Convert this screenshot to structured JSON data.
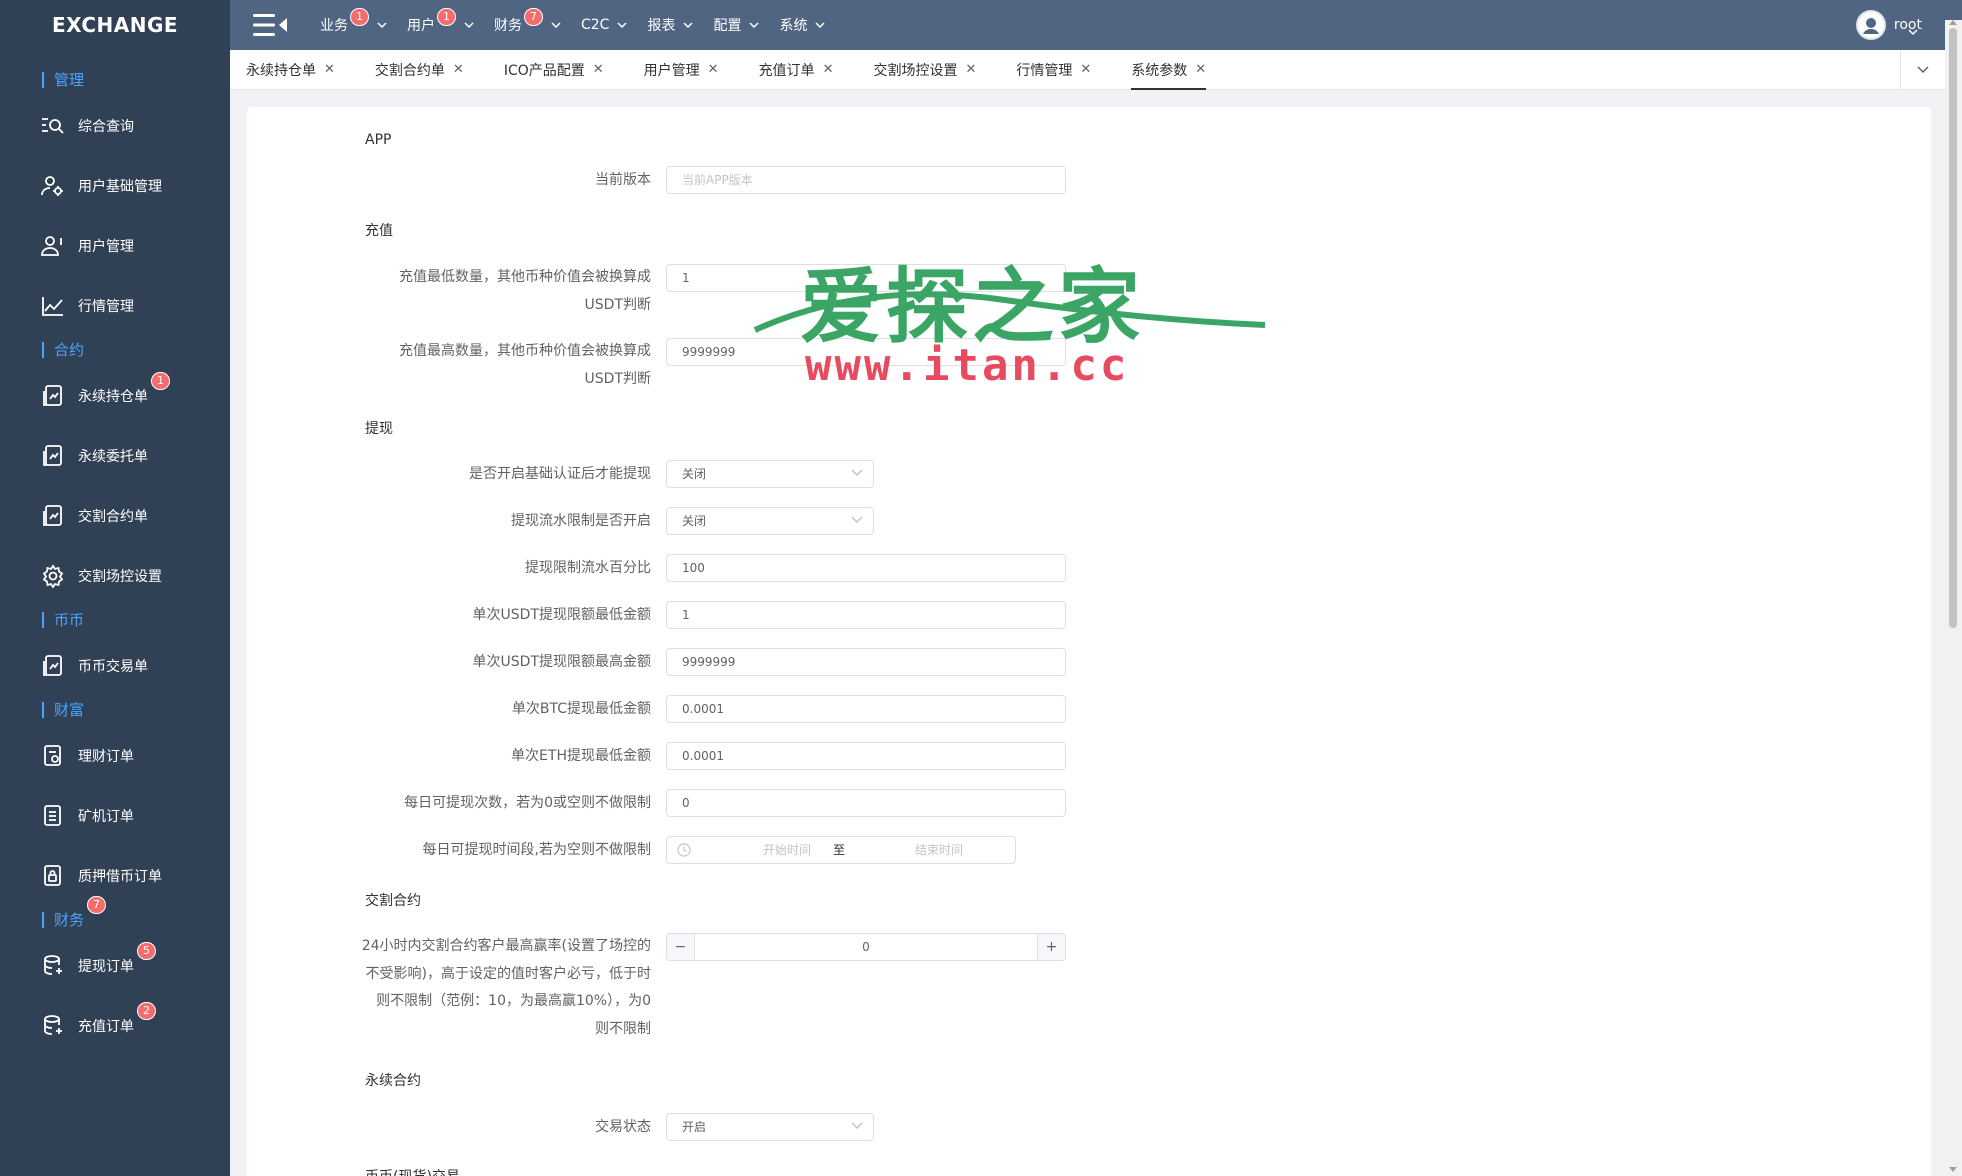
{
  "app": {
    "logo": "EXCHANGE"
  },
  "sidebar": {
    "groups": {
      "manage": "管理",
      "contract": "合约",
      "coin": "币币",
      "wealth": "财富",
      "finance": "财务",
      "finance_badge": "7"
    },
    "items": [
      {
        "label": "综合查询",
        "icon": "search-list-icon"
      },
      {
        "label": "用户基础管理",
        "icon": "user-settings-icon"
      },
      {
        "label": "用户管理",
        "icon": "user-icon"
      },
      {
        "label": "行情管理",
        "icon": "line-chart-icon"
      },
      {
        "label": "永续持仓单",
        "icon": "document-chart-icon",
        "badge": "1"
      },
      {
        "label": "永续委托单",
        "icon": "document-chart-icon"
      },
      {
        "label": "交割合约单",
        "icon": "document-chart-icon"
      },
      {
        "label": "交割场控设置",
        "icon": "gear-icon"
      },
      {
        "label": "币币交易单",
        "icon": "document-chart-icon"
      },
      {
        "label": "理财订单",
        "icon": "document-icon"
      },
      {
        "label": "矿机订单",
        "icon": "document-list-icon"
      },
      {
        "label": "质押借币订单",
        "icon": "document-lock-icon"
      },
      {
        "label": "提现订单",
        "icon": "database-icon",
        "badge": "5"
      },
      {
        "label": "充值订单",
        "icon": "database-icon",
        "badge": "2"
      }
    ]
  },
  "topbar": {
    "menus": [
      {
        "label": "业务",
        "badge": "1"
      },
      {
        "label": "用户",
        "badge": "1"
      },
      {
        "label": "财务",
        "badge": "7"
      },
      {
        "label": "C2C"
      },
      {
        "label": "报表"
      },
      {
        "label": "配置"
      },
      {
        "label": "系统"
      }
    ],
    "username": "root"
  },
  "tabs": [
    {
      "label": "永续持仓单"
    },
    {
      "label": "交割合约单"
    },
    {
      "label": "ICO产品配置"
    },
    {
      "label": "用户管理"
    },
    {
      "label": "充值订单"
    },
    {
      "label": "交割场控设置"
    },
    {
      "label": "行情管理"
    },
    {
      "label": "系统参数",
      "active": true
    }
  ],
  "form": {
    "sections": {
      "app": "APP",
      "recharge": "充值",
      "withdraw": "提现",
      "delivery": "交割合约",
      "perpetual": "永续合约",
      "spot": "币币(现货)交易"
    },
    "app_version": {
      "label": "当前版本",
      "placeholder": "当前APP版本",
      "value": ""
    },
    "recharge_min": {
      "label_line1": "充值最低数量，其他币种价值会被换算成",
      "label_line2": "USDT判断",
      "value": "1"
    },
    "recharge_max": {
      "label_line1": "充值最高数量，其他币种价值会被换算成",
      "label_line2": "USDT判断",
      "value": "9999999"
    },
    "withdraw_kyc": {
      "label": "是否开启基础认证后才能提现",
      "value": "关闭"
    },
    "withdraw_flow": {
      "label": "提现流水限制是否开启",
      "value": "关闭"
    },
    "withdraw_flow_pct": {
      "label": "提现限制流水百分比",
      "value": "100"
    },
    "usdt_min": {
      "label": "单次USDT提现限额最低金额",
      "value": "1"
    },
    "usdt_max": {
      "label": "单次USDT提现限额最高金额",
      "value": "9999999"
    },
    "btc_min": {
      "label": "单次BTC提现最低金额",
      "value": "0.0001"
    },
    "eth_min": {
      "label": "单次ETH提现最低金额",
      "value": "0.0001"
    },
    "daily_count": {
      "label": "每日可提现次数，若为0或空则不做限制",
      "value": "0"
    },
    "time_range": {
      "label": "每日可提现时间段,若为空则不做限制",
      "start_placeholder": "开始时间",
      "separator": "至",
      "end_placeholder": "结束时间"
    },
    "delivery_rate": {
      "label_line1": "24小时内交割合约客户最高赢率(设置了场控的",
      "label_line2": "不受影响)，高于设定的值时客户必亏，低于时",
      "label_line3": "则不限制（范例：10，为最高赢10%），为0",
      "label_line4": "则不限制",
      "value": "0",
      "dec": "−",
      "inc": "+"
    },
    "trade_status": {
      "label": "交易状态",
      "value": "开启"
    }
  },
  "watermark": {
    "cn": "爱探之家",
    "url": "www.itan.cc"
  },
  "colors": {
    "sidebar_bg": "#304156",
    "topbar_bg": "#4f6582",
    "accent": "#4aa3ff",
    "badge": "#f56c6c",
    "watermark_green": "#3aa564",
    "watermark_red": "#e84a5f"
  }
}
